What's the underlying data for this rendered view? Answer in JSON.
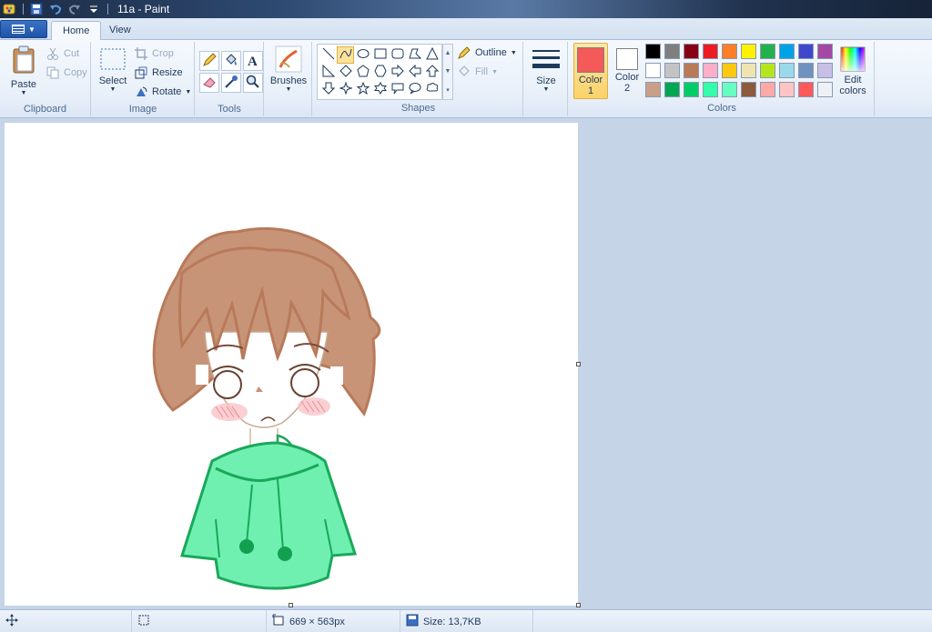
{
  "window": {
    "title": "11a - Paint"
  },
  "tabs": [
    {
      "label": "Home"
    },
    {
      "label": "View"
    }
  ],
  "clipboard": {
    "paste": "Paste",
    "cut": "Cut",
    "copy": "Copy",
    "group": "Clipboard"
  },
  "image": {
    "select": "Select",
    "crop": "Crop",
    "resize": "Resize",
    "rotate": "Rotate",
    "group": "Image"
  },
  "tools": {
    "group": "Tools",
    "icons": [
      "pencil-icon",
      "fill-icon",
      "text-icon",
      "eraser-icon",
      "color-picker-icon",
      "magnifier-icon"
    ]
  },
  "brushes": {
    "label": "Brushes"
  },
  "shapes": {
    "group": "Shapes",
    "outline": "Outline",
    "fill": "Fill"
  },
  "size": {
    "label": "Size"
  },
  "colors": {
    "group": "Colors",
    "color1_line1": "Color",
    "color1_line2": "1",
    "color1_value": "#f45a5a",
    "color2_line1": "Color",
    "color2_line2": "2",
    "color2_value": "#ffffff",
    "edit_line1": "Edit",
    "edit_line2": "colors",
    "palette": [
      "#000000",
      "#7f7f7f",
      "#880015",
      "#ed1c24",
      "#ff7f27",
      "#fff200",
      "#22b14c",
      "#00a2e8",
      "#3f48cc",
      "#a349a4",
      "#ffffff",
      "#c3c3c3",
      "#b97a57",
      "#ffaec9",
      "#ffc90e",
      "#efe4b0",
      "#b5e61d",
      "#99d9ea",
      "#7092be",
      "#c8bfe7",
      "#c8a08a",
      "#00a651",
      "#00cc66",
      "#33ffaa",
      "#66ffc2",
      "#8c5a3c",
      "#ffa8a8",
      "#ffc4c4",
      "#ff5a5a",
      "#eef2f7"
    ]
  },
  "status": {
    "dimensions": "669 × 563px",
    "size": "Size: 13,7KB"
  }
}
